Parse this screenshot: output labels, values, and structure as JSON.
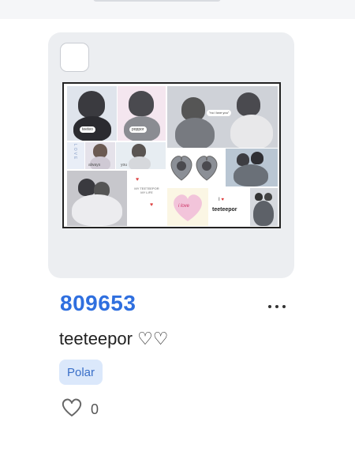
{
  "card": {
    "id": "809653",
    "name": "teeteepor ♡♡",
    "tag": "Polar",
    "likes": "0"
  },
  "collage": {
    "labels": {
      "tile1": "teeteo",
      "tile2": "poppor",
      "tile3_vertical": "LOVE",
      "tile4": "always",
      "tile5": "you",
      "tile8": "MY TEETEEPOR\nMY LIFE",
      "tile9": "i love",
      "tile10": "teeteepor"
    }
  },
  "icons": {
    "more": "more-horizontal-icon",
    "like": "heart-outline-icon"
  },
  "colors": {
    "accent": "#2f6fdf",
    "chip_bg": "#dbe8fb",
    "card_bg": "#eceef1"
  }
}
